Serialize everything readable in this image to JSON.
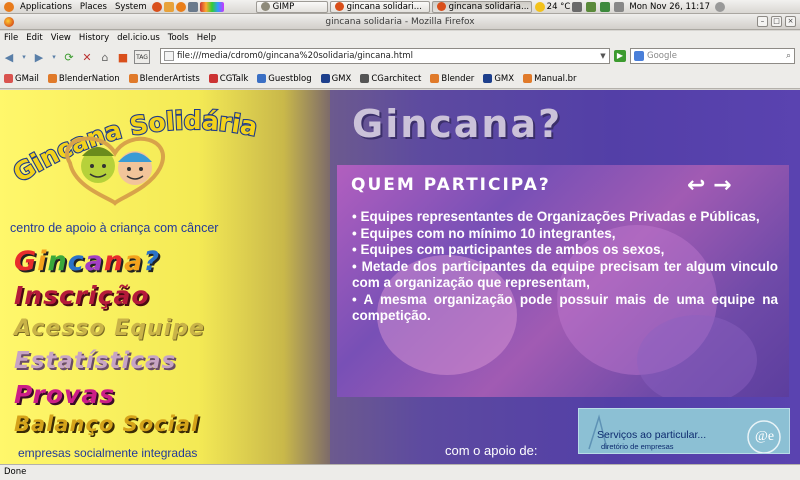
{
  "panel": {
    "menus": [
      "Applications",
      "Places",
      "System"
    ],
    "tasks": [
      {
        "label": "GIMP",
        "active": false
      },
      {
        "label": "gincana solidari...",
        "active": false
      },
      {
        "label": "gincana solidaria...",
        "active": true
      }
    ],
    "weather": "24 °C",
    "clock": "Mon Nov 26, 11:17"
  },
  "window": {
    "title": "gincana solidaria - Mozilla Firefox"
  },
  "menubar": [
    "File",
    "Edit",
    "View",
    "History",
    "del.icio.us",
    "Tools",
    "Help"
  ],
  "navbar": {
    "url": "file:///media/cdrom0/gincana%20solidaria/gincana.html",
    "search_placeholder": "Google",
    "tag_label": "TAG"
  },
  "bookmarks": [
    {
      "label": "GMail",
      "color": "#d9534f"
    },
    {
      "label": "BlenderNation",
      "color": "#e07a2a"
    },
    {
      "label": "BlenderArtists",
      "color": "#e07a2a"
    },
    {
      "label": "CGTalk",
      "color": "#c33"
    },
    {
      "label": "Guestblog",
      "color": "#3a6fc4"
    },
    {
      "label": "GMX",
      "color": "#1d3f8c"
    },
    {
      "label": "CGarchitect",
      "color": "#555"
    },
    {
      "label": "Blender",
      "color": "#e07a2a"
    },
    {
      "label": "GMX",
      "color": "#1d3f8c"
    },
    {
      "label": "Manual.br",
      "color": "#e07a2a"
    }
  ],
  "page": {
    "logo_title": "Gincana Solidária",
    "subtitle": "centro de apoio à criança com câncer",
    "nav": {
      "gincana": "Gincana?",
      "inscricao": "Inscrição",
      "acesso": "Acesso Equipe",
      "estatisticas": "Estatísticas",
      "provas": "Provas",
      "balanco": "Balanço Social"
    },
    "footer_left": "empresas socialmente integradas",
    "heading": "Gincana?",
    "section_title": "QUEM PARTICIPA?",
    "items": [
      "• Equipes representantes de Organizações Privadas e Públicas,",
      "• Equipes com no mínimo 10 integrantes,",
      "• Equipes com participantes de ambos os sexos,",
      "• Metade dos participantes da equipe precisam ter algum vinculo com a organização que representam,",
      "• A mesma organização pode possuir mais de uma equipe na competição."
    ],
    "apoio_label": "com o apoio de:",
    "sponsor_name": "Serviços ao particular...",
    "sponsor_tag": "diretório de empresas",
    "sponsor_mark": "@e"
  },
  "status": "Done",
  "colors": {
    "nav_gincana_letters": [
      "#e82c2c",
      "#f4a21c",
      "#3aa83a",
      "#2b72c8",
      "#a33fc4",
      "#e82c2c",
      "#f4a21c",
      "#2b72c8"
    ]
  }
}
